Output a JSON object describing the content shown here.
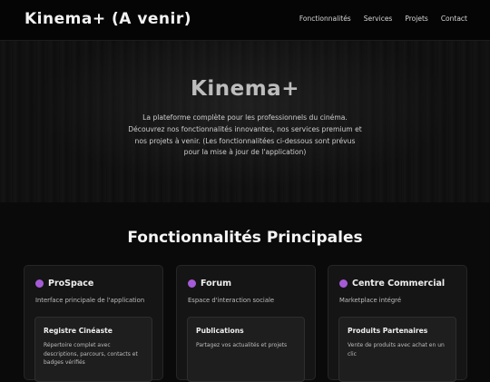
{
  "header": {
    "brand": "Kinema+ (A venir)",
    "nav": [
      "Fonctionnalités",
      "Services",
      "Projets",
      "Contact"
    ]
  },
  "hero": {
    "title": "Kinema+",
    "description": "La plateforme complète pour les professionnels du cinéma. Découvrez nos fonctionnalités innovantes, nos services premium et nos projets à venir. (Les fonctionnalitées ci-dessous sont prévus pour la mise à jour de l'application)"
  },
  "features": {
    "title": "Fonctionnalités Principales",
    "cards": [
      {
        "title": "ProSpace",
        "subtitle": "Interface principale de l'application",
        "item_title": "Registre Cinéaste",
        "item_desc": "Répertoire complet avec descriptions, parcours, contacts et badges vérifiés"
      },
      {
        "title": "Forum",
        "subtitle": "Espace d'interaction sociale",
        "item_title": "Publications",
        "item_desc": "Partagez vos actualités et projets"
      },
      {
        "title": "Centre Commercial",
        "subtitle": "Marketplace intégré",
        "item_title": "Produits Partenaires",
        "item_desc": "Vente de produits avec achat en un clic"
      }
    ]
  },
  "colors": {
    "background": "#0a0a0a",
    "accent_dot": "#a55bd6"
  }
}
